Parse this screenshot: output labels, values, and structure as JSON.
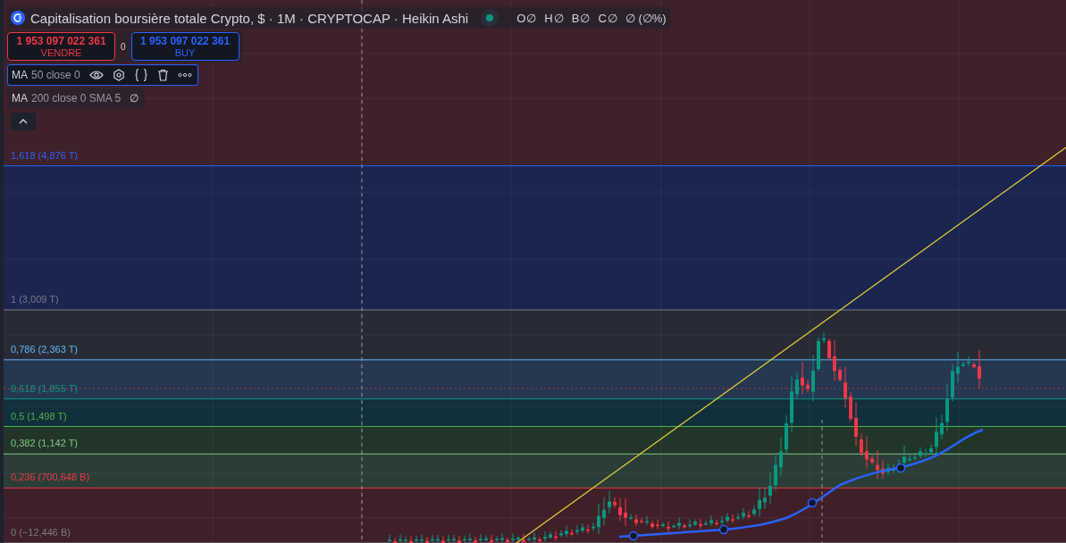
{
  "legend": {
    "title": "Capitalisation boursière totale Crypto, $ · 1M · CRYPTOCAP · Heikin Ashi",
    "market_open": true,
    "ohlc": [
      {
        "label": "O",
        "value": "∅"
      },
      {
        "label": "H",
        "value": "∅"
      },
      {
        "label": "B",
        "value": "∅"
      },
      {
        "label": "C",
        "value": "∅"
      }
    ],
    "change": "∅ (∅%)"
  },
  "trade": {
    "sell": {
      "price": "1 953 097 022 361",
      "label": "VENDRE"
    },
    "spread": "0",
    "buy": {
      "price": "1 953 097 022 361",
      "label": "BUY"
    }
  },
  "indicators": [
    {
      "name": "MA",
      "params": "50 close 0",
      "selected": true
    },
    {
      "name": "MA",
      "params": "200 close 0 SMA 5",
      "selected": false,
      "value": "∅"
    }
  ],
  "fib_levels": [
    {
      "label": "1,618 (4,876 T)",
      "color": "#2962ff"
    },
    {
      "label": "1 (3,009 T)",
      "color": "#787b86"
    },
    {
      "label": "0,786 (2,363 T)",
      "color": "#64b5f6"
    },
    {
      "label": "0,618 (1,855 T)",
      "color": "#089981"
    },
    {
      "label": "0,5 (1,498 T)",
      "color": "#4caf50"
    },
    {
      "label": "0,382 (1,142 T)",
      "color": "#81c784"
    },
    {
      "label": "0,236 (700,648 B)",
      "color": "#f23645"
    },
    {
      "label": "0 (−12,446 B)",
      "color": "#787b86"
    }
  ]
}
